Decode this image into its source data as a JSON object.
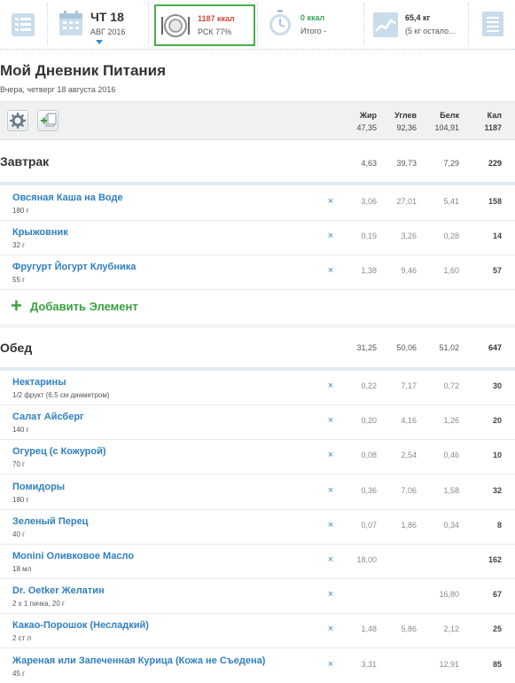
{
  "topbar": {
    "date": {
      "day": "ЧТ 18",
      "month": "АВГ 2016"
    },
    "calories": {
      "value": "1187 ккал",
      "label": "РСК 77%"
    },
    "exercise": {
      "value": "0 ккал",
      "label": "Итого -"
    },
    "weight": {
      "value": "65,4 кг",
      "label": "(5 кг остало..."
    }
  },
  "page": {
    "title": "Мой Дневник Питания",
    "subtitle": "Вчера, четверг 18 августа 2016"
  },
  "summary": {
    "columns": [
      {
        "label": "Жир",
        "value": "47,35"
      },
      {
        "label": "Углев",
        "value": "92,36"
      },
      {
        "label": "Белк",
        "value": "104,91"
      },
      {
        "label": "Кал",
        "value": "1187"
      }
    ]
  },
  "breakfast": {
    "name": "Завтрак",
    "totals": [
      "4,63",
      "39,73",
      "7,29",
      "229"
    ],
    "items": [
      {
        "name": "Овсяная Каша на Воде",
        "qty": "180 г",
        "fat": "3,06",
        "carb": "27,01",
        "prot": "5,41",
        "kcal": "158"
      },
      {
        "name": "Крыжовник",
        "qty": "32 г",
        "fat": "0,19",
        "carb": "3,26",
        "prot": "0,28",
        "kcal": "14"
      },
      {
        "name": "Фругурт Йогурт Клубника",
        "qty": "55 г",
        "fat": "1,38",
        "carb": "9,46",
        "prot": "1,60",
        "kcal": "57"
      }
    ],
    "add_label": "Добавить Элемент"
  },
  "lunch": {
    "name": "Обед",
    "totals": [
      "31,25",
      "50,06",
      "51,02",
      "647"
    ],
    "items": [
      {
        "name": "Нектарины",
        "qty": "1/2 фрукт (6,5 см диаметром)",
        "fat": "0,22",
        "carb": "7,17",
        "prot": "0,72",
        "kcal": "30"
      },
      {
        "name": "Салат Айсберг",
        "qty": "140 г",
        "fat": "0,20",
        "carb": "4,16",
        "prot": "1,26",
        "kcal": "20"
      },
      {
        "name": "Огурец (с Кожурой)",
        "qty": "70 г",
        "fat": "0,08",
        "carb": "2,54",
        "prot": "0,46",
        "kcal": "10"
      },
      {
        "name": "Помидоры",
        "qty": "180 г",
        "fat": "0,36",
        "carb": "7,06",
        "prot": "1,58",
        "kcal": "32"
      },
      {
        "name": "Зеленый Перец",
        "qty": "40 г",
        "fat": "0,07",
        "carb": "1,86",
        "prot": "0,34",
        "kcal": "8"
      },
      {
        "name": "Monini Оливковое Масло",
        "qty": "18 мл",
        "fat": "18,00",
        "carb": "",
        "prot": "",
        "kcal": "162"
      },
      {
        "name": "Dr. Oetker Желатин",
        "qty": "2 x 1 пачка, 20 г",
        "fat": "",
        "carb": "",
        "prot": "16,80",
        "kcal": "67"
      },
      {
        "name": "Какао-Порошок (Несладкий)",
        "qty": "2 ст л",
        "fat": "1,48",
        "carb": "5,86",
        "prot": "2,12",
        "kcal": "25"
      },
      {
        "name": "Жареная или Запеченная Курица (Кожа не Съедена)",
        "qty": "45 г",
        "fat": "3,31",
        "carb": "",
        "prot": "12,91",
        "kcal": "85"
      }
    ]
  },
  "delete_symbol": "×",
  "colors": {
    "accent": "#2f7fc0",
    "green": "#3aa03d",
    "red": "#d24a3c"
  }
}
